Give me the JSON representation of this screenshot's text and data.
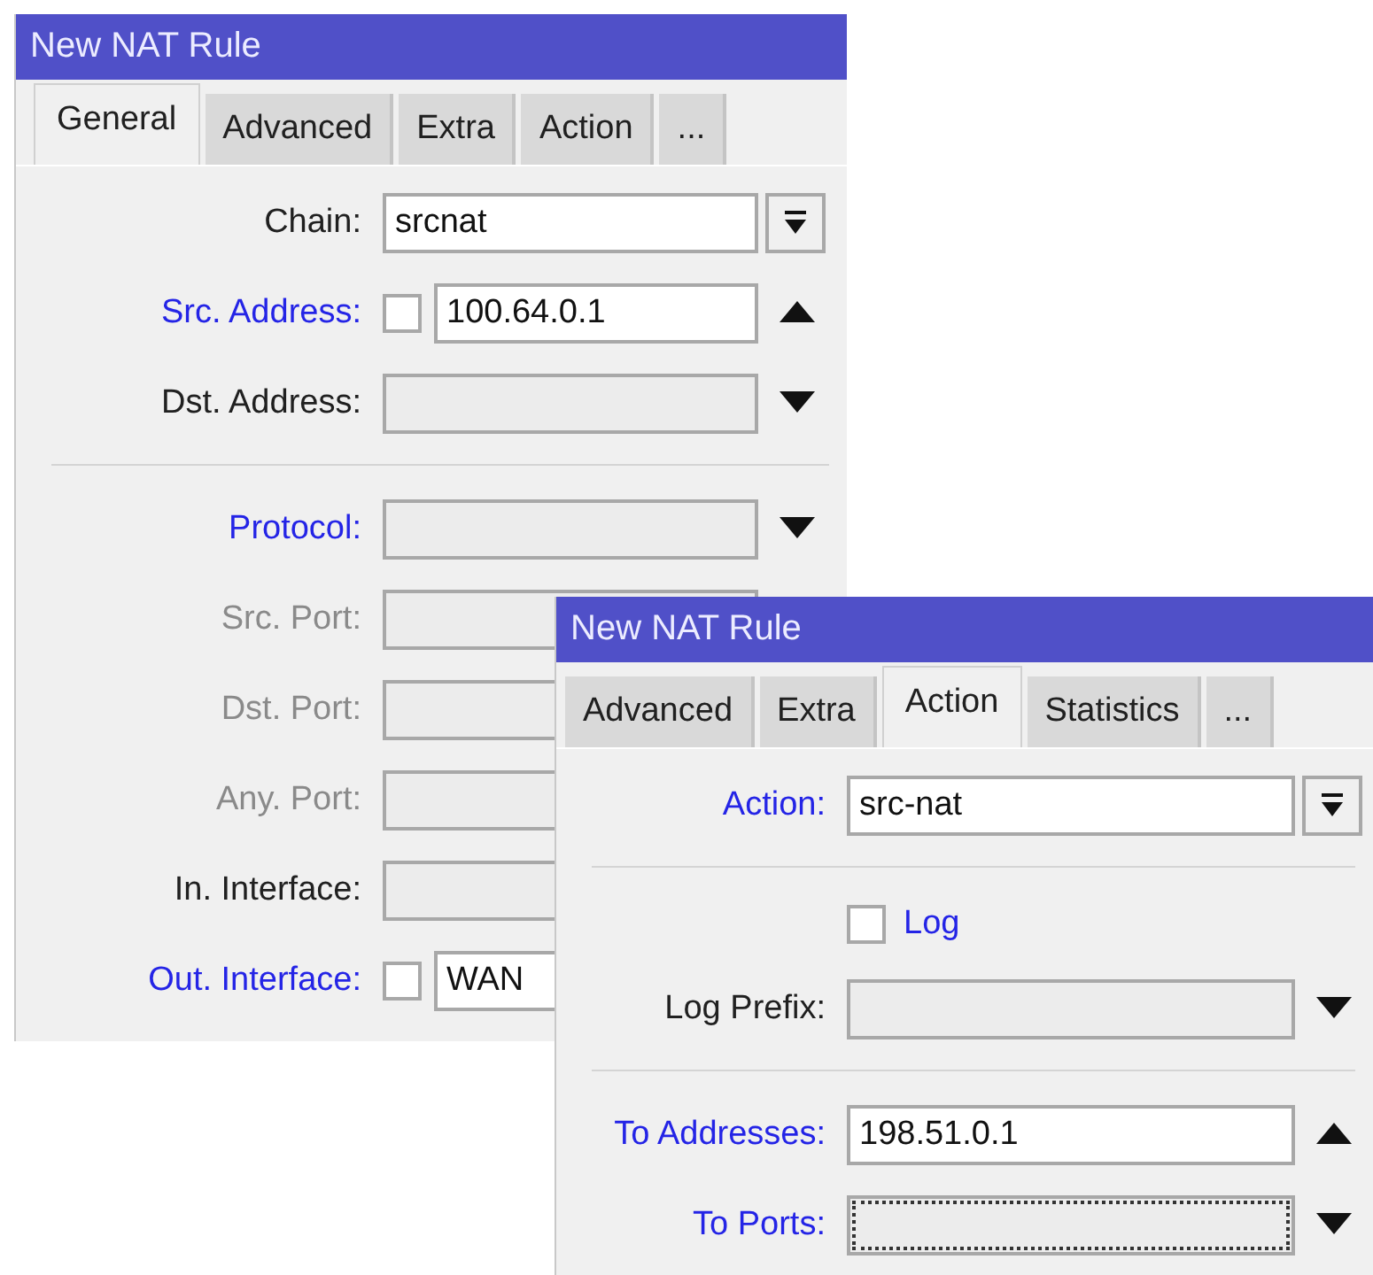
{
  "windows": [
    {
      "title": "New NAT Rule",
      "tabs": [
        {
          "label": "General",
          "selected": true
        },
        {
          "label": "Advanced",
          "selected": false
        },
        {
          "label": "Extra",
          "selected": false
        },
        {
          "label": "Action",
          "selected": false
        },
        {
          "label": "...",
          "selected": false
        }
      ],
      "rows": [
        {
          "kind": "dropdown",
          "label": "Chain:",
          "highlighted": false,
          "disabled": false,
          "value": "srcnat"
        },
        {
          "kind": "field",
          "label": "Src. Address:",
          "highlighted": true,
          "disabled": false,
          "negate_checked": false,
          "value": "100.64.0.1",
          "expanded": true
        },
        {
          "kind": "field",
          "label": "Dst. Address:",
          "highlighted": false,
          "disabled": false,
          "expanded": false
        },
        {
          "kind": "separator"
        },
        {
          "kind": "field",
          "label": "Protocol:",
          "highlighted": true,
          "disabled": false,
          "expanded": false
        },
        {
          "kind": "field",
          "label": "Src. Port:",
          "disabled": true
        },
        {
          "kind": "field",
          "label": "Dst. Port:",
          "disabled": true
        },
        {
          "kind": "field",
          "label": "Any. Port:",
          "disabled": true
        },
        {
          "kind": "field",
          "label": "In. Interface:",
          "highlighted": false,
          "disabled": false
        },
        {
          "kind": "field",
          "label": "Out. Interface:",
          "highlighted": true,
          "disabled": false,
          "negate_checked": false,
          "value": "WAN"
        }
      ]
    },
    {
      "title": "New NAT Rule",
      "tabs": [
        {
          "label": "Advanced",
          "selected": false
        },
        {
          "label": "Extra",
          "selected": false
        },
        {
          "label": "Action",
          "selected": true
        },
        {
          "label": "Statistics",
          "selected": false
        },
        {
          "label": "...",
          "selected": false
        }
      ],
      "rows": [
        {
          "kind": "dropdown",
          "label": "Action:",
          "highlighted": true,
          "disabled": false,
          "value": "src-nat"
        },
        {
          "kind": "separator"
        },
        {
          "kind": "checkbox",
          "label": "Log",
          "highlighted": true,
          "disabled": false,
          "checked": false
        },
        {
          "kind": "field",
          "label": "Log Prefix:",
          "highlighted": false,
          "disabled": false,
          "expanded": false
        },
        {
          "kind": "separator"
        },
        {
          "kind": "field",
          "label": "To Addresses:",
          "highlighted": true,
          "disabled": false,
          "value": "198.51.0.1",
          "expanded": true
        },
        {
          "kind": "field",
          "label": "To Ports:",
          "highlighted": true,
          "disabled": false,
          "expanded": false,
          "focused": true
        }
      ]
    }
  ]
}
